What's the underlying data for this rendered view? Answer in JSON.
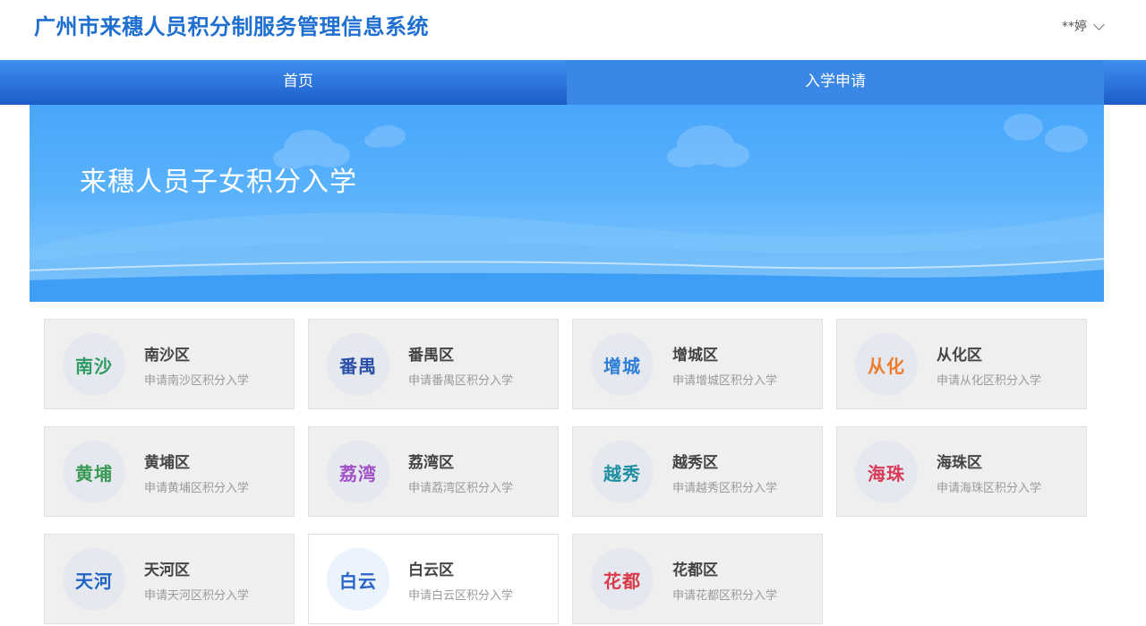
{
  "header": {
    "site_title": "广州市来穗人员积分制服务管理信息系统",
    "user_name": "**婷"
  },
  "nav": {
    "tabs": [
      {
        "label": "首页",
        "active": false
      },
      {
        "label": "入学申请",
        "active": true
      }
    ]
  },
  "banner": {
    "title": "来穗人员子女积分入学"
  },
  "colors": {
    "brand_blue": "#1f6fd1",
    "nav_gradient_top": "#3f8ff0",
    "nav_gradient_bottom": "#1b5dc7",
    "active_tab": "#3a87e6"
  },
  "districts": [
    {
      "logo_text": "南沙",
      "logo_color": "#2e9a63",
      "name": "南沙区",
      "desc": "申请南沙区积分入学"
    },
    {
      "logo_text": "番禺",
      "logo_color": "#2b4fa8",
      "name": "番禺区",
      "desc": "申请番禺区积分入学"
    },
    {
      "logo_text": "增城",
      "logo_color": "#2e7fd6",
      "name": "增城区",
      "desc": "申请增城区积分入学"
    },
    {
      "logo_text": "从化",
      "logo_color": "#ef7b2b",
      "name": "从化区",
      "desc": "申请从化区积分入学"
    },
    {
      "logo_text": "黄埔",
      "logo_color": "#3a9a55",
      "name": "黄埔区",
      "desc": "申请黄埔区积分入学"
    },
    {
      "logo_text": "荔湾",
      "logo_color": "#a14fc7",
      "name": "荔湾区",
      "desc": "申请荔湾区积分入学"
    },
    {
      "logo_text": "越秀",
      "logo_color": "#1d8fa0",
      "name": "越秀区",
      "desc": "申请越秀区积分入学"
    },
    {
      "logo_text": "海珠",
      "logo_color": "#d93a57",
      "name": "海珠区",
      "desc": "申请海珠区积分入学"
    },
    {
      "logo_text": "天河",
      "logo_color": "#1f63c4",
      "name": "天河区",
      "desc": "申请天河区积分入学"
    },
    {
      "logo_text": "白云",
      "logo_color": "#2a63c8",
      "name": "白云区",
      "desc": "申请白云区积分入学",
      "selected": true
    },
    {
      "logo_text": "花都",
      "logo_color": "#d83a4a",
      "name": "花都区",
      "desc": "申请花都区积分入学"
    }
  ]
}
